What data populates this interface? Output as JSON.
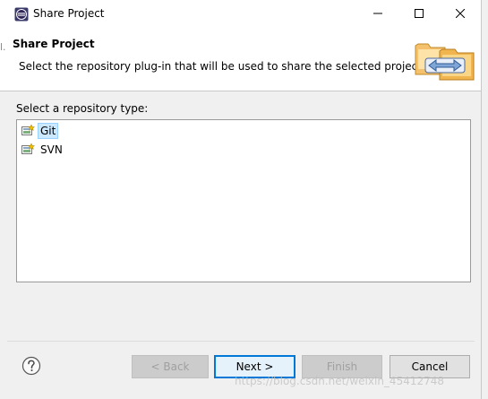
{
  "window": {
    "title": "Share Project",
    "controls": {
      "minimize": "minimize-icon",
      "maximize": "maximize-icon",
      "close": "close-icon"
    }
  },
  "header": {
    "title": "Share Project",
    "description": "Select the repository plug-in that will be used to share the selected project.",
    "banner_icon": "share-folders-icon"
  },
  "content": {
    "list_label": "Select a repository type:",
    "repositories": [
      {
        "label": "Git",
        "icon": "git-plugin-icon",
        "selected": true
      },
      {
        "label": "SVN",
        "icon": "svn-plugin-icon",
        "selected": false
      }
    ]
  },
  "footer": {
    "help_icon": "help-icon",
    "buttons": {
      "back": {
        "label": "< Back",
        "enabled": false
      },
      "next": {
        "label": "Next >",
        "enabled": true,
        "default": true
      },
      "finish": {
        "label": "Finish",
        "enabled": false
      },
      "cancel": {
        "label": "Cancel",
        "enabled": true
      }
    }
  },
  "background_fragment": "l.",
  "watermark": "https://blog.csdn.net/weixin_45412748",
  "colors": {
    "selection_bg": "#cce8ff",
    "selection_border": "#99d1ff",
    "default_button_border": "#0078d7",
    "dialog_bg": "#f0f0f0"
  }
}
